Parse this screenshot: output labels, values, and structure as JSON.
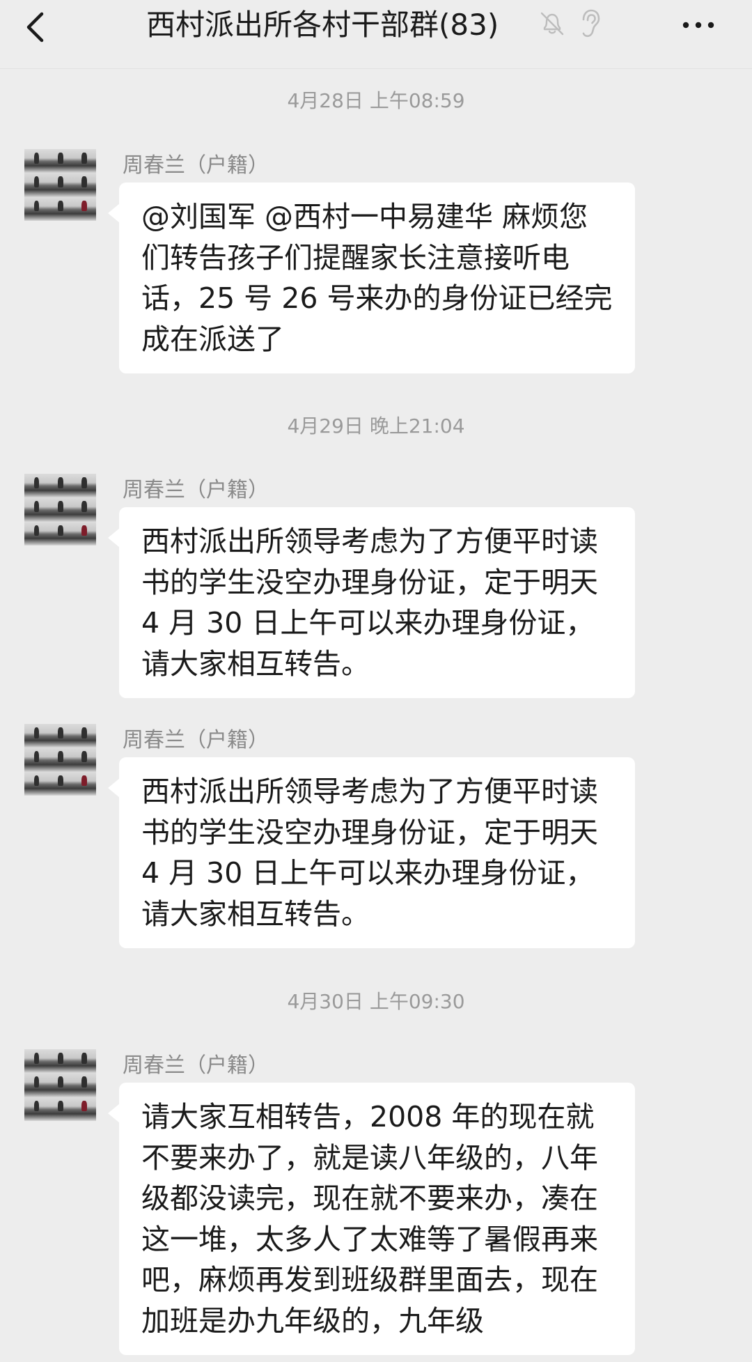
{
  "header": {
    "title": "西村派出所各村干部群(83)",
    "back_icon": "chevron-left-icon",
    "mute_icon": "bell-muted-icon",
    "earpiece_icon": "earpiece-mode-icon",
    "more_icon": "ellipsis-icon"
  },
  "messages": [
    {
      "timestamp": "4月28日 上午08:59",
      "sender": "周春兰（户籍）",
      "text": "@刘国军 @西村一中易建华 麻烦您们转告孩子们提醒家长注意接听电话，25 号 26 号来办的身份证已经完成在派送了"
    },
    {
      "timestamp": "4月29日 晚上21:04",
      "sender": "周春兰（户籍）",
      "text": "西村派出所领导考虑为了方便平时读书的学生没空办理身份证，定于明天 4 月 30 日上午可以来办理身份证，请大家相互转告。"
    },
    {
      "sender": "周春兰（户籍）",
      "text": "西村派出所领导考虑为了方便平时读书的学生没空办理身份证，定于明天 4 月 30 日上午可以来办理身份证，请大家相互转告。"
    },
    {
      "timestamp": "4月30日 上午09:30",
      "sender": "周春兰（户籍）",
      "text": "请大家互相转告，2008 年的现在就不要来办了，就是读八年级的，八年级都没读完，现在就不要来办，凑在这一堆，太多人了太难等了暑假再来吧，麻烦再发到班级群里面去，现在加班是办九年级的，九年级"
    }
  ],
  "colors": {
    "background": "#ededed",
    "bubble": "#ffffff",
    "timestamp_text": "#9a9a9a",
    "sender_text": "#8a8a8a"
  }
}
